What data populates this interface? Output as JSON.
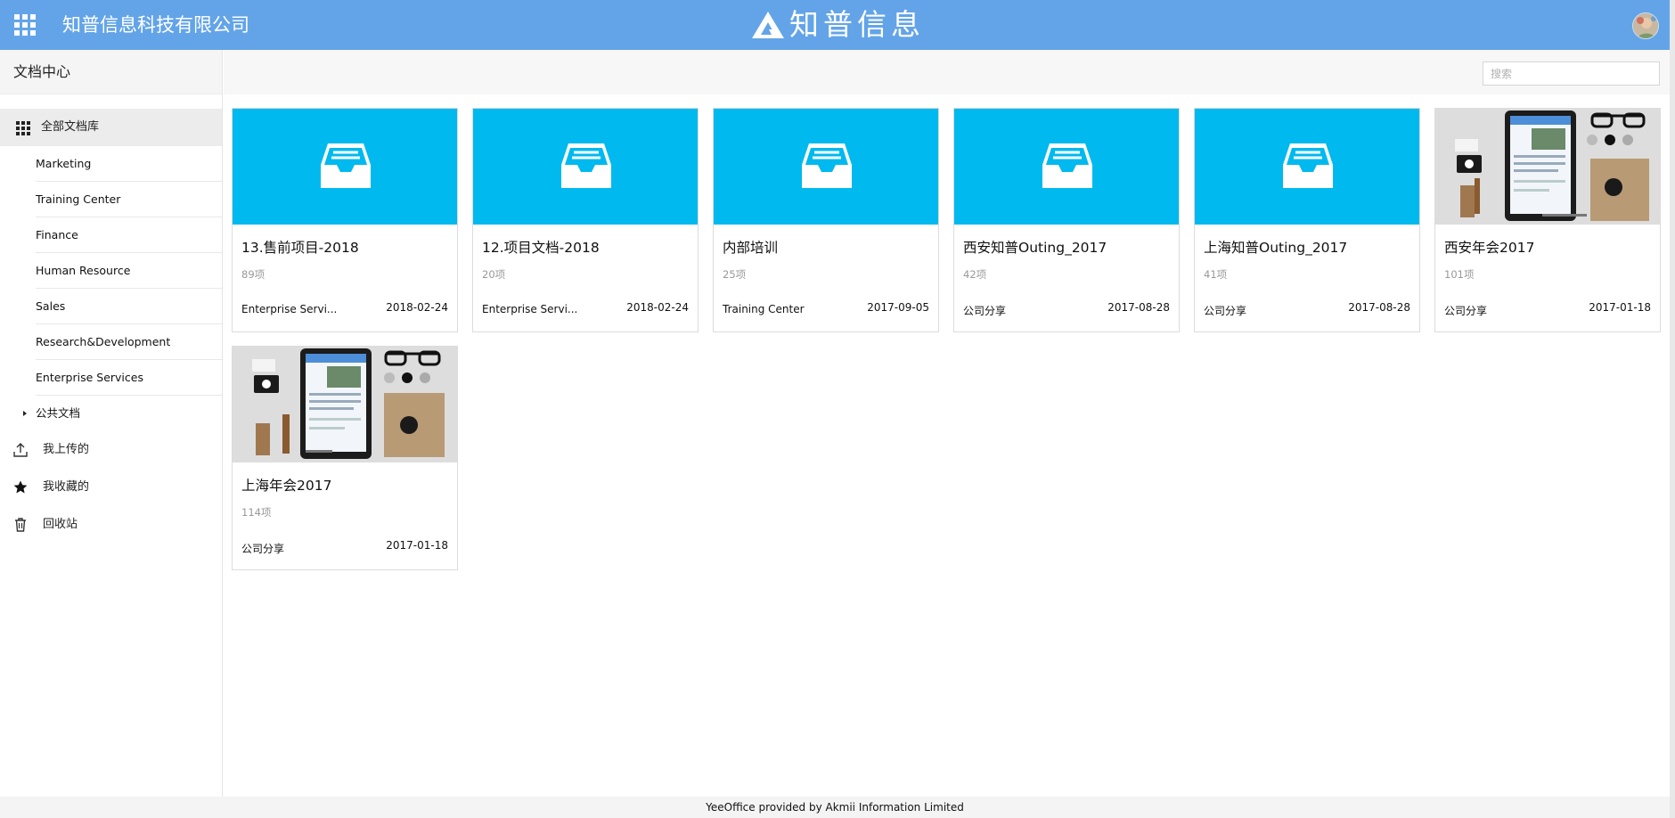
{
  "header": {
    "company_name": "知普信息科技有限公司",
    "brand_text": "知普信息",
    "bar_color": "#63a4e8"
  },
  "sidebar": {
    "title": "文档中心",
    "all_libraries_label": "全部文档库",
    "libraries": [
      {
        "label": "Marketing"
      },
      {
        "label": "Training Center"
      },
      {
        "label": "Finance"
      },
      {
        "label": "Human Resource"
      },
      {
        "label": "Sales"
      },
      {
        "label": "Research&Development"
      },
      {
        "label": "Enterprise Services"
      },
      {
        "label": "公共文档",
        "collapsed": true
      }
    ],
    "nav": [
      {
        "label": "我上传的",
        "icon": "upload-icon"
      },
      {
        "label": "我收藏的",
        "icon": "star-icon"
      },
      {
        "label": "回收站",
        "icon": "trash-icon"
      }
    ]
  },
  "toolbar": {
    "search_placeholder": "搜索"
  },
  "cards": [
    {
      "title": "13.售前项目-2018",
      "count": "89项",
      "category": "Enterprise Servi...",
      "date": "2018-02-24",
      "thumb": "folder"
    },
    {
      "title": "12.项目文档-2018",
      "count": "20项",
      "category": "Enterprise Servi...",
      "date": "2018-02-24",
      "thumb": "folder"
    },
    {
      "title": "内部培训",
      "count": "25项",
      "category": "Training Center",
      "date": "2017-09-05",
      "thumb": "folder"
    },
    {
      "title": "西安知普Outing_2017",
      "count": "42项",
      "category": "公司分享",
      "date": "2017-08-28",
      "thumb": "folder"
    },
    {
      "title": "上海知普Outing_2017",
      "count": "41项",
      "category": "公司分享",
      "date": "2017-08-28",
      "thumb": "folder"
    },
    {
      "title": "西安年会2017",
      "count": "101项",
      "category": "公司分享",
      "date": "2017-01-18",
      "thumb": "photo"
    },
    {
      "title": "上海年会2017",
      "count": "114项",
      "category": "公司分享",
      "date": "2017-01-18",
      "thumb": "photo"
    }
  ],
  "colors": {
    "folder_thumb": "#00b9ef",
    "sidebar_active_bg": "#ececec"
  },
  "footer": {
    "text": "YeeOffice provided by Akmii Information Limited"
  }
}
